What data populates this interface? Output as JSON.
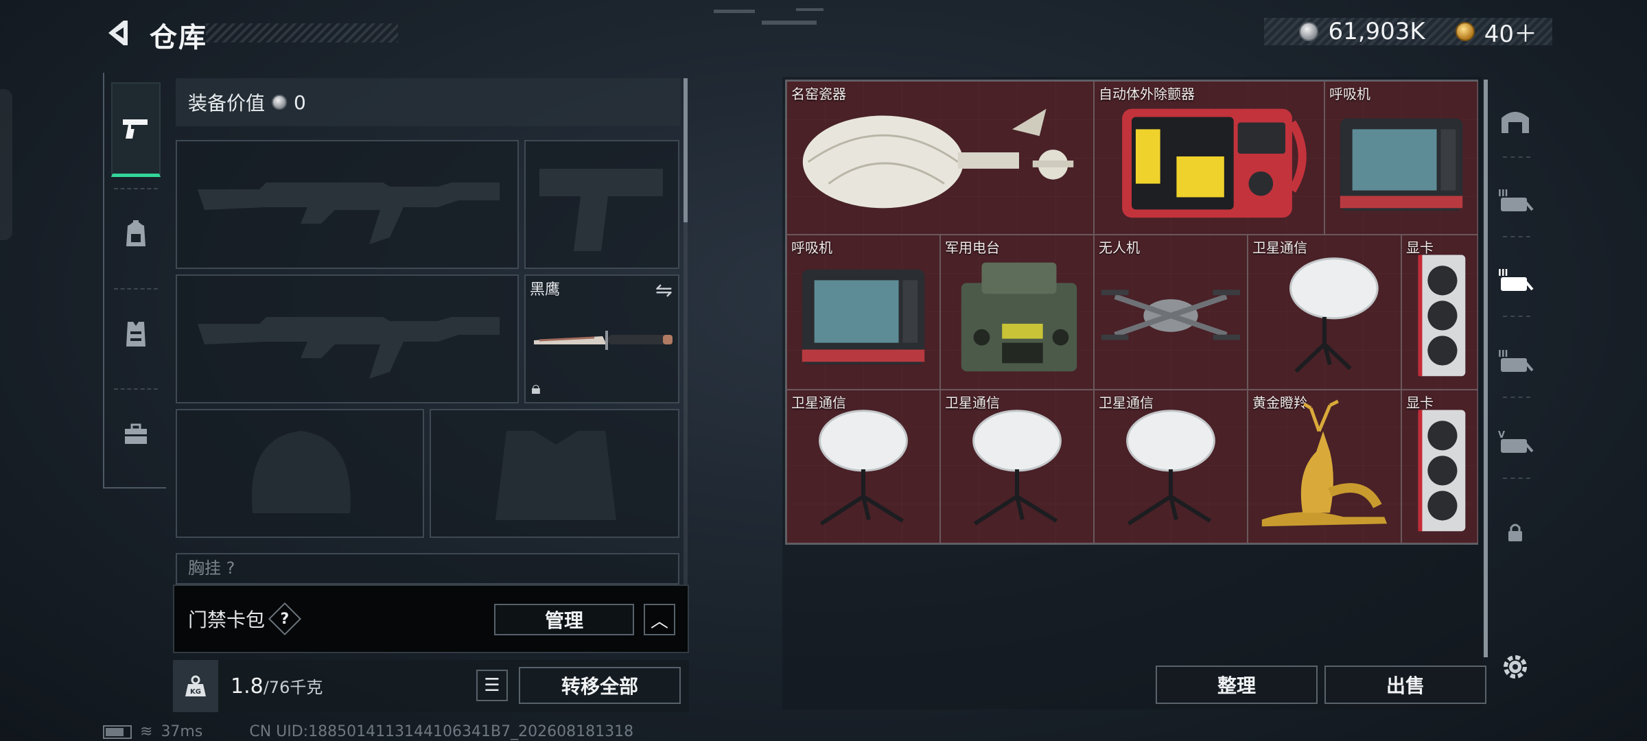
{
  "header": {
    "title": "仓库",
    "currency_silver": "61,903K",
    "currency_gold": "40＋"
  },
  "left_rail": {
    "tabs": [
      {
        "name": "weapons",
        "icon": "pistol-icon",
        "active": true
      },
      {
        "name": "backpack",
        "icon": "backpack-icon",
        "active": false
      },
      {
        "name": "vest",
        "icon": "vest-icon",
        "active": false
      },
      {
        "name": "toolbox",
        "icon": "toolbox-icon",
        "active": false
      }
    ]
  },
  "equipment": {
    "value_label": "装备价值",
    "value_amount": "0",
    "melee_slot_name": "黑鹰",
    "chest_rig_label": "胸挂",
    "chest_rig_help": "?"
  },
  "keycard": {
    "label": "门禁卡包",
    "help": "?",
    "manage_label": "管理"
  },
  "weight": {
    "current": "1.8",
    "max": "/76千克",
    "transfer_all_label": "转移全部"
  },
  "status": {
    "ping": "37ms",
    "uid": "CN UID:1885014113144106341B7_202608181318"
  },
  "stash": {
    "items": [
      {
        "name": "名窑瓷器",
        "kind": "vase"
      },
      {
        "name": "自动体外除颤器",
        "kind": "aed"
      },
      {
        "name": "呼吸机",
        "kind": "ventilator"
      },
      {
        "name": "呼吸机",
        "kind": "ventilator"
      },
      {
        "name": "军用电台",
        "kind": "radio"
      },
      {
        "name": "无人机",
        "kind": "drone"
      },
      {
        "name": "卫星通信",
        "kind": "dish"
      },
      {
        "name": "显卡",
        "kind": "gpu"
      },
      {
        "name": "卫星通信",
        "kind": "dish"
      },
      {
        "name": "卫星通信",
        "kind": "dish"
      },
      {
        "name": "卫星通信",
        "kind": "dish"
      },
      {
        "name": "黄金瞪羚",
        "kind": "gazelle"
      },
      {
        "name": "显卡",
        "kind": "gpu"
      }
    ],
    "tidy_label": "整理",
    "sell_label": "出售"
  },
  "right_rail": {
    "tabs": [
      {
        "name": "stash-home",
        "icon": "warehouse-icon"
      },
      {
        "name": "page-3",
        "icon": "stash-page-icon",
        "label": "III"
      },
      {
        "name": "page-current",
        "icon": "stash-page-icon",
        "label": "III",
        "active": true
      },
      {
        "name": "page-other",
        "icon": "stash-page-icon",
        "label": "III"
      },
      {
        "name": "page-v",
        "icon": "stash-page-icon",
        "label": "V"
      },
      {
        "name": "locked-page",
        "icon": "lock-icon"
      }
    ]
  },
  "colors": {
    "accent_green": "#33d59a",
    "stash_bg": "#3b1f24",
    "item_cell": "#56222a"
  }
}
